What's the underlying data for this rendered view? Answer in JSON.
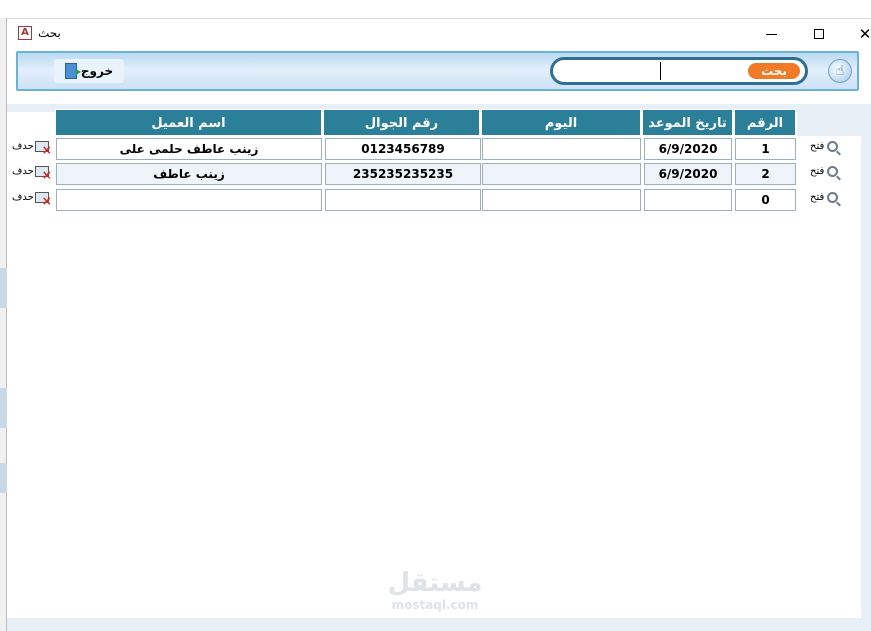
{
  "window": {
    "title": "بحث",
    "app_icon": "A"
  },
  "toolbar": {
    "exit_label": "خروج",
    "search_value": "",
    "search_button_label": "بحث"
  },
  "columns": {
    "customer_name": "اسم العميل",
    "mobile": "رقم الجوال",
    "day": "اليوم",
    "appointment_date": "تاريخ الموعد",
    "number": "الرقم"
  },
  "row_actions": {
    "delete_label": "حدف",
    "open_label": "فتح"
  },
  "rows": [
    {
      "customer_name": "زينب عاطف حلمى على",
      "mobile": "0123456789",
      "day": "",
      "appointment_date": "6/9/2020",
      "number": "1"
    },
    {
      "customer_name": "زينب عاطف",
      "mobile": "235235235235",
      "day": "",
      "appointment_date": "6/9/2020",
      "number": "2"
    },
    {
      "customer_name": "",
      "mobile": "",
      "day": "",
      "appointment_date": "",
      "number": "0"
    }
  ],
  "watermark": {
    "main": "مستقل",
    "sub": "mostaql.com"
  },
  "colors": {
    "header_bg": "#2b7f98",
    "search_button": "#f07a26",
    "toolbar_border": "#6bb2d9"
  }
}
